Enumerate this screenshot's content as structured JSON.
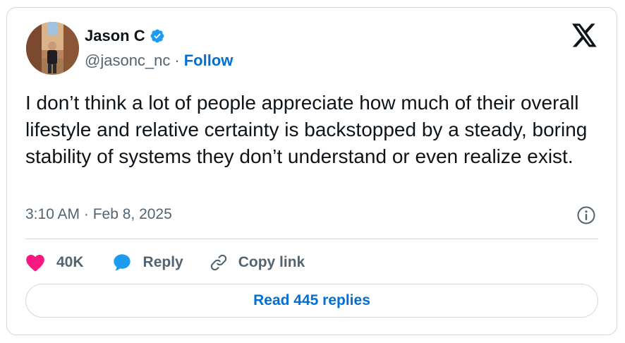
{
  "author": {
    "name": "Jason C",
    "handle": "@jasonc_nc",
    "separator": "·",
    "follow_label": "Follow",
    "verified": true
  },
  "tweet": {
    "text": "I don’t think a lot of people appreciate how much of their overall lifestyle and relative certainty is backstopped by a steady, boring stability of systems they don’t understand or even realize exist.",
    "timestamp": "3:10 AM · Feb 8, 2025"
  },
  "actions": {
    "like_count": "40K",
    "reply_label": "Reply",
    "copy_link_label": "Copy link"
  },
  "read_replies_label": "Read 445 replies",
  "icons": {
    "logo": "x-logo-icon",
    "verified": "verified-badge-icon",
    "info": "info-icon",
    "like": "heart-icon",
    "reply": "reply-bubble-icon",
    "copy": "link-icon"
  },
  "colors": {
    "accent": "#1d9bf0",
    "link": "#006fd6",
    "like": "#f91880",
    "secondary_text": "#536471",
    "border": "#cfd9de"
  }
}
